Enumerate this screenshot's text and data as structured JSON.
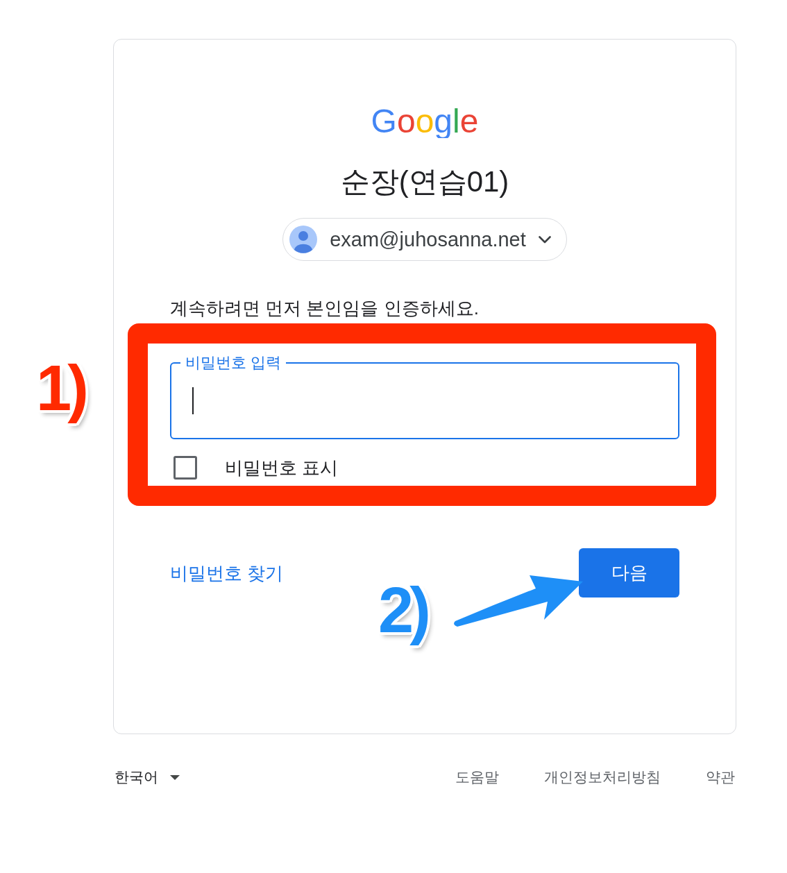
{
  "logo": "Google",
  "title": "순장(연습01)",
  "account": {
    "email": "exam@juhosanna.net"
  },
  "instruction": "계속하려면 먼저 본인임을 인증하세요.",
  "password_field": {
    "label": "비밀번호 입력",
    "focused": true
  },
  "show_password": {
    "label": "비밀번호 표시",
    "checked": false
  },
  "forgot_password_link": "비밀번호 찾기",
  "next_button": "다음",
  "footer": {
    "language": "한국어",
    "links": [
      "도움말",
      "개인정보처리방침",
      "약관"
    ]
  },
  "annotations": [
    {
      "kind": "frame",
      "color": "#ff2a00"
    },
    {
      "kind": "step",
      "label": "1)",
      "color": "#ff2a00"
    },
    {
      "kind": "step",
      "label": "2)",
      "color": "#1e8ff7"
    },
    {
      "kind": "arrow",
      "color": "#1e8ff7"
    }
  ]
}
